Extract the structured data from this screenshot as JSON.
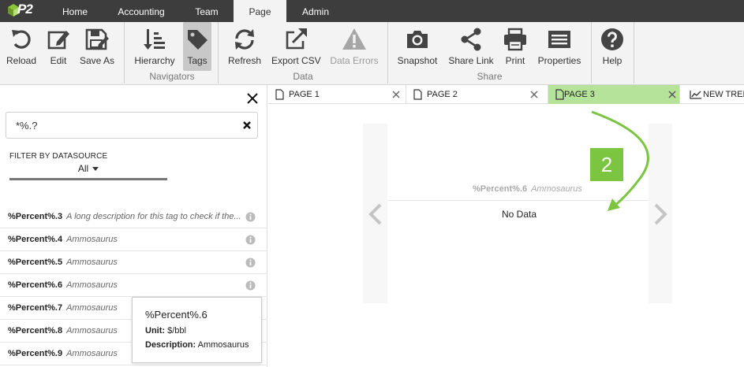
{
  "app": {
    "logo_text": "P2"
  },
  "topnav": {
    "tabs": [
      "Home",
      "Accounting",
      "Team",
      "Page",
      "Admin"
    ],
    "active": "Page"
  },
  "ribbon": {
    "reload": "Reload",
    "edit": "Edit",
    "save_as": "Save As",
    "hierarchy": "Hierarchy",
    "tags": "Tags",
    "navigators_group": "Navigators",
    "refresh": "Refresh",
    "export_csv": "Export CSV",
    "data_errors": "Data Errors",
    "data_group": "Data",
    "snapshot": "Snapshot",
    "share_link": "Share Link",
    "print": "Print",
    "properties": "Properties",
    "share_group": "Share",
    "help": "Help"
  },
  "left_panel": {
    "search": {
      "value": "*%.?"
    },
    "filter": {
      "label": "FILTER BY DATASOURCE",
      "value": "All"
    },
    "tags": [
      {
        "name": "%Percent%.3",
        "desc": "A long description for this tag to check if the..."
      },
      {
        "name": "%Percent%.4",
        "desc": "Ammosaurus"
      },
      {
        "name": "%Percent%.5",
        "desc": "Ammosaurus"
      },
      {
        "name": "%Percent%.6",
        "desc": "Ammosaurus"
      },
      {
        "name": "%Percent%.7",
        "desc": "Ammosaurus"
      },
      {
        "name": "%Percent%.8",
        "desc": "Ammosaurus"
      },
      {
        "name": "%Percent%.9",
        "desc": "Ammosaurus"
      }
    ],
    "tooltip": {
      "title": "%Percent%.6",
      "unit_label": "Unit:",
      "unit_value": "$/bbl",
      "desc_label": "Description:",
      "desc_value": "Ammosaurus"
    }
  },
  "doc_tabs": [
    {
      "label": "PAGE 1"
    },
    {
      "label": "PAGE 2"
    },
    {
      "label": "PAGE 3"
    },
    {
      "label": "NEW TRENI"
    }
  ],
  "active_doc_tab": "PAGE 3",
  "trend": {
    "tag_name": "%Percent%.6",
    "tag_desc": "Ammosaurus",
    "status": "No Data"
  },
  "annotation": {
    "step": "2"
  },
  "colors": {
    "nav_bg": "#3d3d3d",
    "active_tab": "#b6e39a",
    "callout": "#7cc540"
  }
}
